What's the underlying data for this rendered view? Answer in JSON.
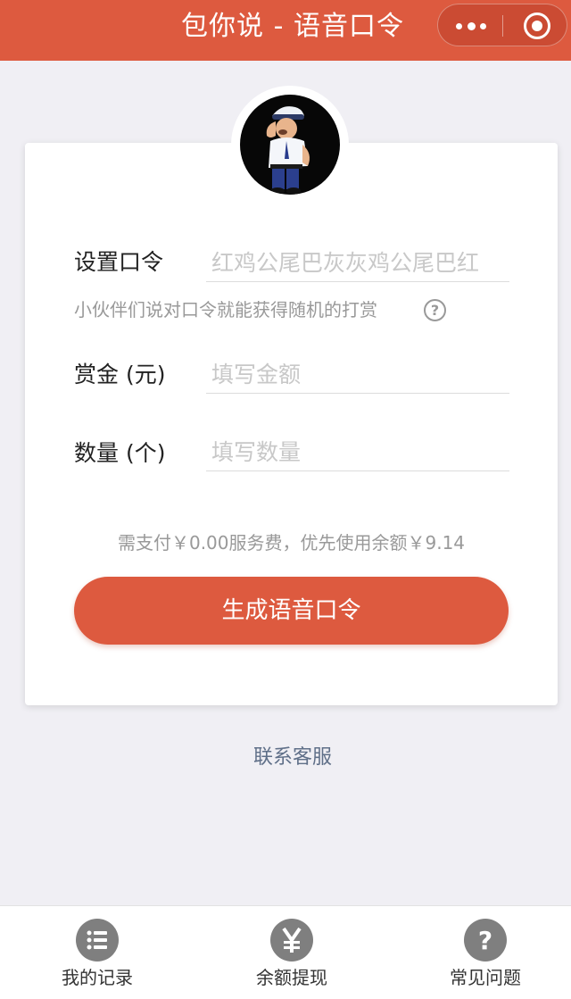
{
  "header": {
    "title": "包你说 - 语音口令",
    "more_icon": "more-dots-icon",
    "close_icon": "mini-program-close-icon",
    "color": "#dd5a3f"
  },
  "avatar": {
    "icon": "cartoon-mascot-avatar"
  },
  "form": {
    "password_label": "设置口令",
    "password_value": "红鸡公尾巴灰灰鸡公尾巴红",
    "hint": "小伙伴们说对口令就能获得随机的打赏",
    "hint_icon": "question-circle-icon",
    "amount_label": "赏金 (元)",
    "amount_placeholder": "填写金额",
    "count_label": "数量 (个)",
    "count_placeholder": "填写数量"
  },
  "fee_text": "需支付￥0.00服务费，优先使用余额￥9.14",
  "generate_button": "生成语音口令",
  "contact_link": "联系客服",
  "tabbar": {
    "items": [
      {
        "label": "我的记录",
        "icon": "list-icon"
      },
      {
        "label": "余额提现",
        "icon": "yen-icon"
      },
      {
        "label": "常见问题",
        "icon": "question-icon"
      }
    ]
  }
}
